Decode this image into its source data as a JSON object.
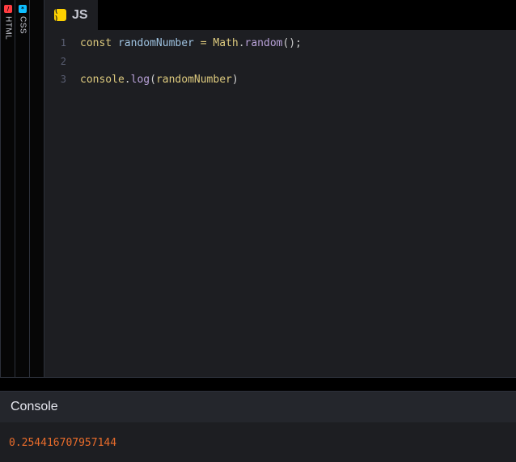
{
  "side_panels": {
    "html": {
      "badge_icon": "html-icon",
      "label": "HTML",
      "color": "#ff3c41"
    },
    "css": {
      "badge_icon": "css-icon",
      "label": "CSS",
      "color": "#0ebeff"
    }
  },
  "editor": {
    "tab": {
      "icon": "js-icon",
      "badge_text": "( )",
      "label": "JS",
      "color": "#fcd000"
    },
    "lines": [
      {
        "number": "1"
      },
      {
        "number": "2"
      },
      {
        "number": "3"
      }
    ],
    "tokens": {
      "line1": {
        "kw": "const",
        "var": "randomNumber",
        "op": "=",
        "obj": "Math",
        "dot": ".",
        "fn": "random",
        "punc": "();"
      },
      "line3": {
        "obj": "console",
        "dot": ".",
        "fn": "log",
        "open": "(",
        "arg": "randomNumber",
        "close": ")"
      }
    }
  },
  "console": {
    "title": "Console",
    "output": "0.254416707957144",
    "output_color": "#e96c2b"
  }
}
